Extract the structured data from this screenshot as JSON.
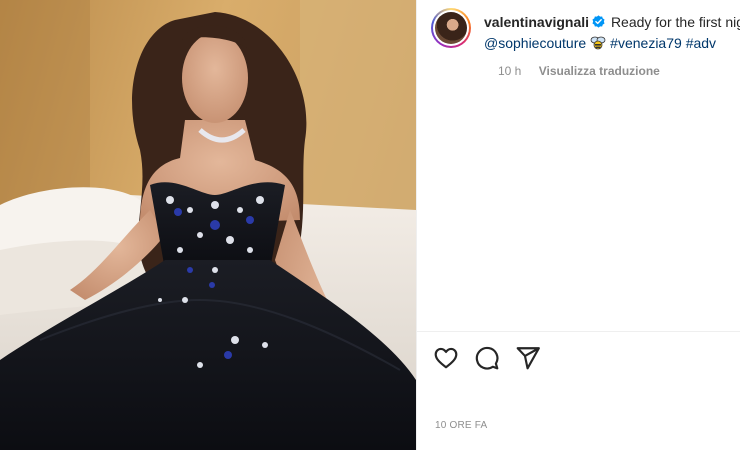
{
  "post": {
    "image_alt": "Woman in black embellished strapless tulle gown sitting on a bed",
    "caption": {
      "username": "valentinavignali",
      "text_start": "Ready for the first nigh",
      "mention": "@sophiecouture",
      "hashtag_1": "#venezia79",
      "hashtag_2": "#adv"
    },
    "meta": {
      "time": "10 h",
      "translate_label": "Visualizza traduzione"
    },
    "footer_date": "10 ORE FA"
  },
  "icons": {
    "verified": "verified-badge-icon",
    "bee": "bee-emoji-icon",
    "like": "heart-icon",
    "comment": "comment-bubble-icon",
    "share": "paper-plane-icon"
  },
  "colors": {
    "link": "#00376b",
    "muted": "#8e8e8e",
    "verified": "#0095f6",
    "text": "#262626"
  }
}
